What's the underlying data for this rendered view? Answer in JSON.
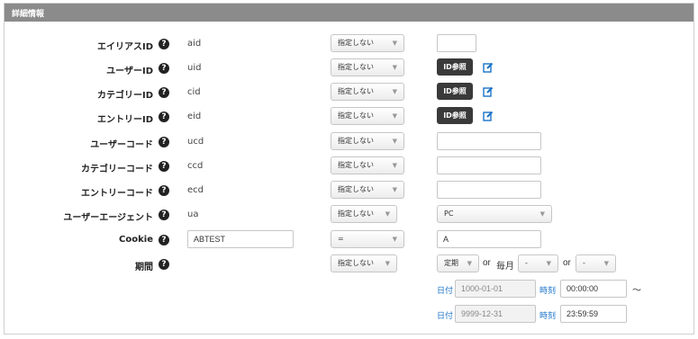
{
  "panel": {
    "title": "詳細情報"
  },
  "help_glyph": "?",
  "rows": [
    {
      "label": "エイリアスID",
      "key": "aid",
      "filter": "指定しない"
    },
    {
      "label": "ユーザーID",
      "key": "uid",
      "filter": "指定しない",
      "ref_button": "ID参照"
    },
    {
      "label": "カテゴリーID",
      "key": "cid",
      "filter": "指定しない",
      "ref_button": "ID参照"
    },
    {
      "label": "エントリーID",
      "key": "eid",
      "filter": "指定しない",
      "ref_button": "ID参照"
    },
    {
      "label": "ユーザーコード",
      "key": "ucd",
      "filter": "指定しない"
    },
    {
      "label": "カテゴリーコード",
      "key": "ccd",
      "filter": "指定しない"
    },
    {
      "label": "エントリーコード",
      "key": "ecd",
      "filter": "指定しない"
    },
    {
      "label": "ユーザーエージェント",
      "key": "ua",
      "filter": "指定しない",
      "value_select": "PC"
    },
    {
      "label": "Cookie",
      "key_input": "ABTEST",
      "filter": "=",
      "value": "A"
    },
    {
      "label": "期間",
      "filter": "指定しない"
    }
  ],
  "period": {
    "cycle": "定期",
    "or1": "or",
    "monthly": "毎月",
    "month_select": "-",
    "or2": "or",
    "day_select": "-",
    "date_label": "日付",
    "time_label": "時刻",
    "start_date": "1000-01-01",
    "start_time": "00:00:00",
    "tilde": "〜",
    "end_date": "9999-12-31",
    "end_time": "23:59:59"
  },
  "caret": "▼",
  "icons": {
    "help": "question-circle-icon",
    "edit": "pencil-square-icon"
  },
  "colors": {
    "header": "#8b8b8b",
    "link_blue": "#1a73c8",
    "button_dark": "#3a3a3a"
  }
}
